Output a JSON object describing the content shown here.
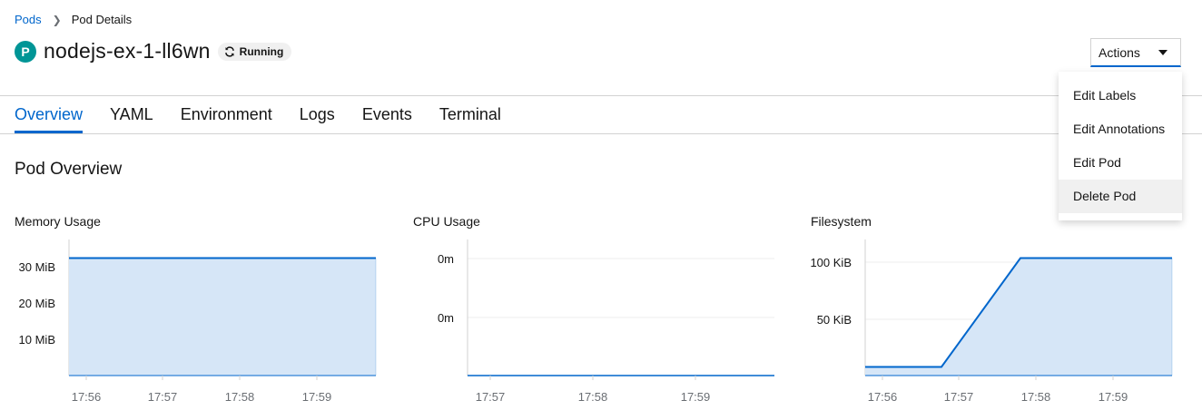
{
  "breadcrumb": {
    "parent": "Pods",
    "current": "Pod Details"
  },
  "header": {
    "badge": "P",
    "title": "nodejs-ex-1-ll6wn",
    "status": "Running",
    "actions_label": "Actions"
  },
  "tabs": [
    {
      "label": "Overview",
      "active": true
    },
    {
      "label": "YAML"
    },
    {
      "label": "Environment"
    },
    {
      "label": "Logs"
    },
    {
      "label": "Events"
    },
    {
      "label": "Terminal"
    }
  ],
  "section_title": "Pod Overview",
  "actions_menu": [
    "Edit Labels",
    "Edit Annotations",
    "Edit Pod",
    "Delete Pod"
  ],
  "colors": {
    "link": "#0066cc",
    "area_fill": "#d6e6f7",
    "area_stroke": "#0066cc",
    "badge": "#009596"
  },
  "chart_data": [
    {
      "type": "area",
      "title": "Memory Usage",
      "x": [
        "17:56",
        "17:57",
        "17:58",
        "17:59"
      ],
      "y_ticks": [
        "10 MiB",
        "20 MiB",
        "30 MiB"
      ],
      "series": [
        {
          "points": [
            [
              "17:55",
              32
            ],
            [
              "17:59:45",
              32
            ]
          ]
        }
      ],
      "ylim": [
        0,
        35
      ],
      "ylabel_unit": "MiB"
    },
    {
      "type": "area",
      "title": "CPU Usage",
      "x": [
        "17:57",
        "17:58",
        "17:59"
      ],
      "y_ticks": [
        "0m",
        "0m"
      ],
      "series": [
        {
          "points": [
            [
              "17:56",
              0
            ],
            [
              "17:59:45",
              0
            ]
          ]
        }
      ],
      "ylabel_unit": "m"
    },
    {
      "type": "area",
      "title": "Filesystem",
      "x": [
        "17:56",
        "17:57",
        "17:58",
        "17:59"
      ],
      "y_ticks": [
        "50 KiB",
        "100 KiB"
      ],
      "series": [
        {
          "points": [
            [
              "17:55",
              8
            ],
            [
              "17:56:45",
              8
            ],
            [
              "17:57:45",
              104
            ],
            [
              "17:59:45",
              104
            ]
          ]
        }
      ],
      "ylim": [
        0,
        120
      ],
      "ylabel_unit": "KiB"
    }
  ]
}
